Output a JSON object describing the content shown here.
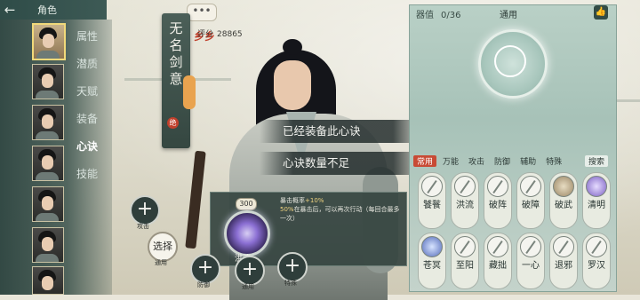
{
  "header": {
    "back_icon": "back-arrow-icon",
    "title": "角色"
  },
  "roster": {
    "menu": [
      {
        "label": "属性",
        "active": false
      },
      {
        "label": "潜质",
        "active": false
      },
      {
        "label": "天赋",
        "active": false
      },
      {
        "label": "装备",
        "active": false
      },
      {
        "label": "心诀",
        "active": true
      },
      {
        "label": "技能",
        "active": false
      }
    ],
    "selected_index": 0
  },
  "title_scroll": {
    "text": "无名剑意",
    "marks": "乡乡",
    "seal": "绝"
  },
  "score": {
    "label": "评分",
    "value": "28865"
  },
  "chat_icon": "chat-bubble-icon",
  "toasts": [
    "已经装备此心诀",
    "心诀数量不足"
  ],
  "skill_popup": {
    "badge": "300",
    "line1_prefix": "暴击概率",
    "line1_pct": "+10%",
    "line2_pct": "50%",
    "line2_rest": "在暴击后，可以再次行动（每回合最多一次）",
    "orb_label": "洪流"
  },
  "buttons": {
    "plus_attack_label": "攻击",
    "select_label": "选择",
    "general_label": "通用",
    "defense_label": "防御",
    "general2_label": "通用",
    "special_label": "特殊"
  },
  "panel": {
    "equip_label": "器值",
    "equip_value": "0/36",
    "title": "通用",
    "thumb_icon": "thumbs-up-icon",
    "tabs": [
      "常用",
      "万能",
      "攻击",
      "防御",
      "辅助",
      "特殊",
      "搜索"
    ],
    "active_tab": 0,
    "skills_row1": [
      "饕餮",
      "洪流",
      "破阵",
      "破障",
      "破武",
      "清明"
    ],
    "skills_row2": [
      "苍冥",
      "至阳",
      "藏拙",
      "一心",
      "退邪",
      "罗汉"
    ]
  },
  "colors": {
    "accent": "#c84a35",
    "panel_bg": "#b9d0c6",
    "left_bg": "#2f4c48",
    "orb": "#8b6fd3"
  }
}
